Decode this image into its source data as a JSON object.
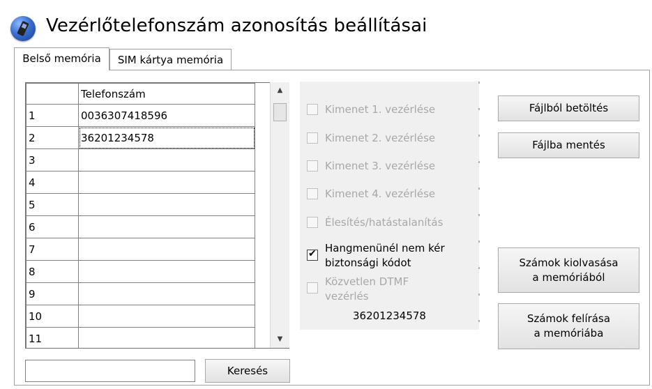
{
  "header": {
    "title": "Vezérlőtelefonszám azonosítás beállításai",
    "icon": "mobile-phone-icon"
  },
  "tabs": [
    {
      "label": "Belső memória",
      "active": true
    },
    {
      "label": "SIM kártya memória",
      "active": false
    }
  ],
  "grid": {
    "column_header": "Telefonszám",
    "rows": [
      {
        "num": "1",
        "value": "0036307418596"
      },
      {
        "num": "2",
        "value": "36201234578"
      },
      {
        "num": "3",
        "value": ""
      },
      {
        "num": "4",
        "value": ""
      },
      {
        "num": "5",
        "value": ""
      },
      {
        "num": "6",
        "value": ""
      },
      {
        "num": "7",
        "value": ""
      },
      {
        "num": "8",
        "value": ""
      },
      {
        "num": "9",
        "value": ""
      },
      {
        "num": "10",
        "value": ""
      },
      {
        "num": "11",
        "value": ""
      }
    ],
    "selected_row": "2"
  },
  "options": [
    {
      "label": "Kimenet 1. vezérlése",
      "checked": false,
      "enabled": false
    },
    {
      "label": "Kimenet 2. vezérlése",
      "checked": false,
      "enabled": false
    },
    {
      "label": "Kimenet 3. vezérlése",
      "checked": false,
      "enabled": false
    },
    {
      "label": "Kimenet 4. vezérlése",
      "checked": false,
      "enabled": false
    },
    {
      "label": "Élesítés/hatástalanítás",
      "checked": false,
      "enabled": false
    },
    {
      "label_line1": "Hangmenünél nem kér",
      "label_line2": "biztonsági kódot",
      "checked": true,
      "enabled": true
    },
    {
      "label_line1": "Közvetlen DTMF",
      "label_line2": "vezérlés",
      "checked": false,
      "enabled": false
    }
  ],
  "selected_number": "36201234578",
  "buttons": {
    "load": "Fájlból betöltés",
    "save": "Fájlba mentés",
    "read_line1": "Számok kiolvasása",
    "read_line2": "a memóriából",
    "write_line1": "Számok felírása",
    "write_line2": "a memóriába",
    "search": "Keresés"
  },
  "search": {
    "value": ""
  }
}
